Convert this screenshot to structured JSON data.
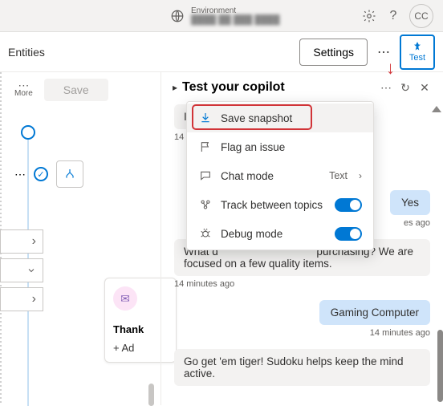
{
  "topbar": {
    "env_label": "Environment",
    "env_name": "████ ██ ███ ████",
    "avatar_initials": "CC"
  },
  "subbar": {
    "entities_label": "Entities",
    "settings_label": "Settings",
    "dots": "⋯",
    "test_label": "Test"
  },
  "leftpane": {
    "more_dots": "⋯",
    "more_label": "More",
    "save_label": "Save",
    "thank_title": "Thank",
    "add_label": "+  Ad"
  },
  "test_panel": {
    "chevron": "▸",
    "title": "Test your copilot",
    "dots": "⋯",
    "refresh": "↻",
    "close": "✕"
  },
  "menu": {
    "save_snapshot": "Save snapshot",
    "flag_issue": "Flag an issue",
    "chat_mode": "Chat mode",
    "chat_mode_value": "Text",
    "track_topics": "Track between topics",
    "debug_mode": "Debug mode"
  },
  "chat": {
    "msg1": "Is that",
    "ts1": "14 minutes ago",
    "user1": "Yes",
    "ts_user1": "es ago",
    "msg2": "What d                                             purchasing? We are focused on a few quality items.",
    "ts2": "14 minutes ago",
    "user2": "Gaming Computer",
    "ts_user2": "14 minutes ago",
    "msg3": "Go get 'em tiger! Sudoku helps keep the mind active."
  }
}
